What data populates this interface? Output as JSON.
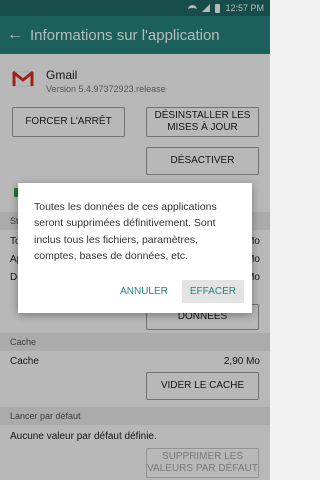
{
  "status": {
    "time": "12:57 PM"
  },
  "appbar": {
    "title": "Informations sur l'application"
  },
  "app": {
    "name": "Gmail",
    "version": "Version 5.4.97372923.release",
    "brand_color": "#d93025"
  },
  "buttons": {
    "force_stop": "FORCER L'ARRÊT",
    "uninstall_updates_line1": "DÉSINSTALLER LES",
    "uninstall_updates_line2": "MISES À JOUR",
    "disable": "DÉSACTIVER",
    "clear_data": "DONNÉES",
    "clear_cache": "VIDER LE CACHE",
    "clear_defaults_line1": "SUPPRIMER LES",
    "clear_defaults_line2": "VALEURS PAR DÉFAUT"
  },
  "partial": {
    "storage_hdr": "St",
    "t1": "To",
    "t1v": "Mo",
    "a1": "Ap",
    "a1v": "Mo",
    "d1": "Do",
    "d1v": "Mo"
  },
  "cache": {
    "header": "Cache",
    "label": "Cache",
    "value": "2,90 Mo"
  },
  "defaults": {
    "header": "Lancer par défaut",
    "text": "Aucune valeur par défaut définie."
  },
  "dialog": {
    "message": "Toutes les données de ces applications seront supprimées définitivement. Sont inclus tous les fichiers, paramètres, comptes, bases de données, etc.",
    "cancel": "ANNULER",
    "confirm": "EFFACER"
  },
  "colors": {
    "accent": "#26857f",
    "statusbar": "#1f6b67"
  }
}
